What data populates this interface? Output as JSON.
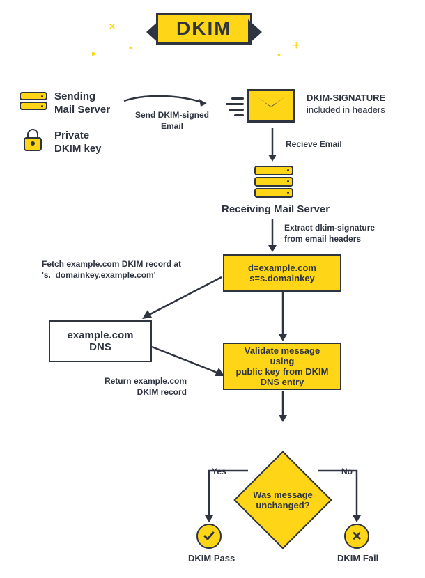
{
  "title": "DKIM",
  "sender": {
    "server_label_l1": "Sending",
    "server_label_l2": "Mail Server",
    "key_label_l1": "Private",
    "key_label_l2": "DKIM key"
  },
  "arrows": {
    "send_l1": "Send DKIM-signed",
    "send_l2": "Email",
    "signature_l1": "DKIM-SIGNATURE",
    "signature_l2": "included in headers",
    "receive": "Recieve Email",
    "extract_l1": "Extract dkim-signature",
    "extract_l2": "from email headers",
    "fetch_l1": "Fetch example.com DKIM record at",
    "fetch_l2": "'s._domainkey.example.com'",
    "return_l1": "Return example.com",
    "return_l2": "DKIM record"
  },
  "receiver_label": "Receiving Mail Server",
  "boxes": {
    "dkim_box_l1": "d=example.com",
    "dkim_box_l2": "s=s.domainkey",
    "dns_l1": "example.com",
    "dns_l2": "DNS",
    "validate_l1": "Validate message using",
    "validate_l2": "public key from DKIM",
    "validate_l3": "DNS entry"
  },
  "decision": {
    "question_l1": "Was message",
    "question_l2": "unchanged?",
    "yes": "Yes",
    "no": "No"
  },
  "results": {
    "pass": "DKIM Pass",
    "fail": "DKIM Fail"
  }
}
